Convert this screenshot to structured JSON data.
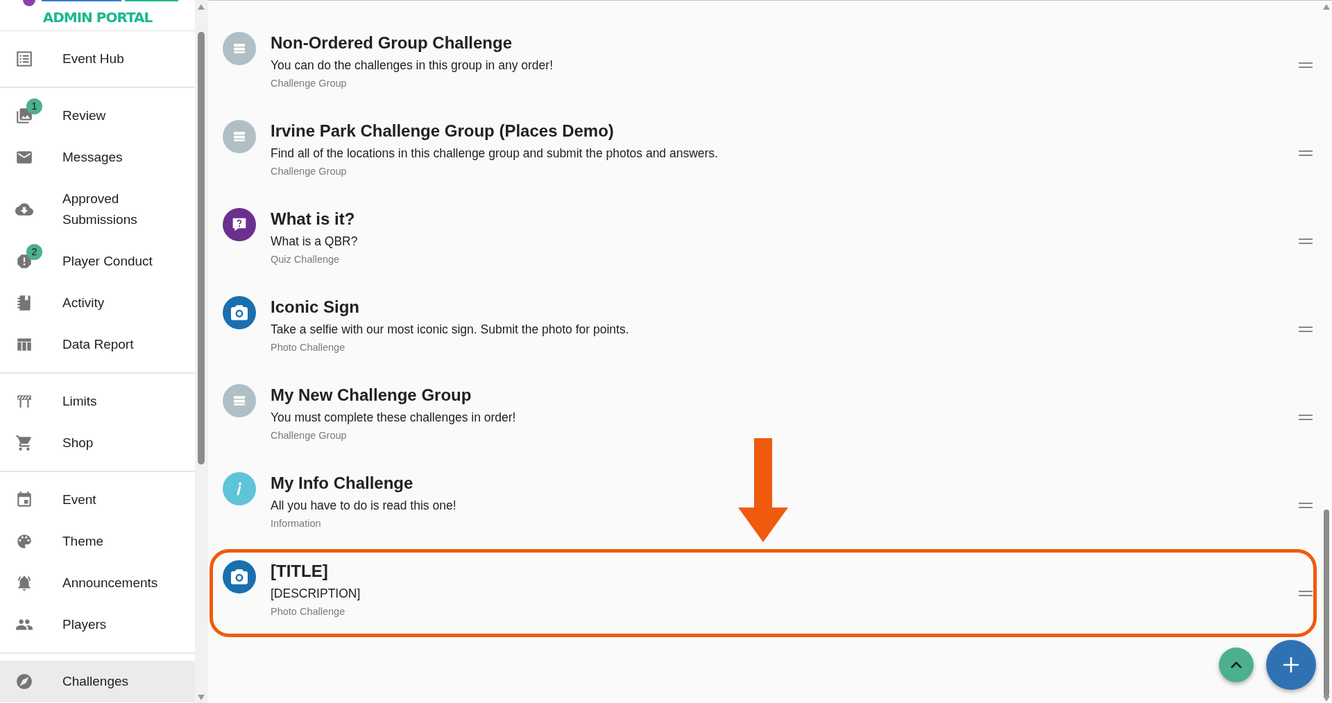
{
  "logo": {
    "subtitle": "ADMIN PORTAL"
  },
  "sidebar": {
    "groups": [
      {
        "items": [
          {
            "label": "Event Hub",
            "selected": false
          }
        ]
      },
      {
        "items": [
          {
            "label": "Review",
            "badge": "1",
            "selected": false
          },
          {
            "label": "Messages",
            "selected": false
          },
          {
            "label": "Approved Submissions",
            "selected": false
          },
          {
            "label": "Player Conduct",
            "badge": "2",
            "selected": false
          },
          {
            "label": "Activity",
            "selected": false
          },
          {
            "label": "Data Report",
            "selected": false
          }
        ]
      },
      {
        "items": [
          {
            "label": "Limits",
            "selected": false
          },
          {
            "label": "Shop",
            "selected": false
          }
        ]
      },
      {
        "items": [
          {
            "label": "Event",
            "selected": false
          },
          {
            "label": "Theme",
            "selected": false
          },
          {
            "label": "Announcements",
            "selected": false
          },
          {
            "label": "Players",
            "selected": false
          }
        ]
      },
      {
        "items": [
          {
            "label": "Challenges",
            "selected": true
          }
        ]
      }
    ]
  },
  "challenges": [
    {
      "kind": "group",
      "title": "Non-Ordered Group Challenge",
      "description": "You can do the challenges in this group in any order!",
      "type": "Challenge Group",
      "highlighted": false
    },
    {
      "kind": "group",
      "title": "Irvine Park Challenge Group (Places Demo)",
      "description": "Find all of the locations in this challenge group and submit the photos and answers.",
      "type": "Challenge Group",
      "highlighted": false
    },
    {
      "kind": "quiz",
      "title": "What is it?",
      "description": "What is a QBR?",
      "type": "Quiz Challenge",
      "highlighted": false
    },
    {
      "kind": "photo",
      "title": "Iconic Sign",
      "description": "Take a selfie with our most iconic sign. Submit the photo for points.",
      "type": "Photo Challenge",
      "highlighted": false
    },
    {
      "kind": "group",
      "title": "My New Challenge Group",
      "description": "You must complete these challenges in order!",
      "type": "Challenge Group",
      "highlighted": false
    },
    {
      "kind": "info",
      "title": "My Info Challenge",
      "description": "All you have to do is read this one!",
      "type": "Information",
      "highlighted": false
    },
    {
      "kind": "photo",
      "title": "[TITLE]",
      "description": "[DESCRIPTION]",
      "type": "Photo Challenge",
      "highlighted": true
    }
  ]
}
